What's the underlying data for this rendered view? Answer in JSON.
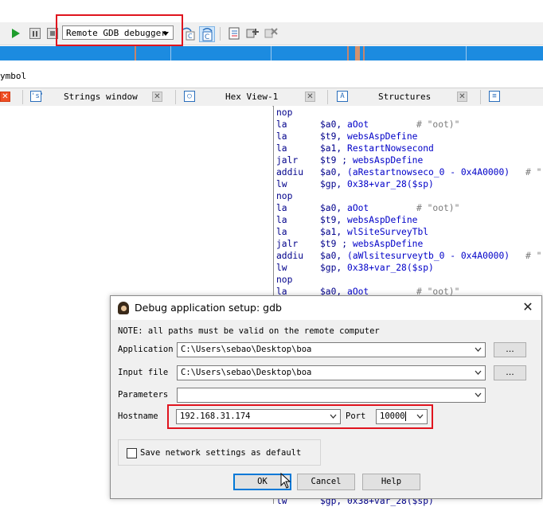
{
  "toolbar": {
    "debugger_select": "Remote GDB debugger"
  },
  "symbol_row": {
    "text": "ymbol"
  },
  "tabs": [
    {
      "label": "Strings window"
    },
    {
      "label": "Hex View-1"
    },
    {
      "label": "Structures"
    }
  ],
  "tab_icons": {
    "strings": "'s'",
    "structures": "A"
  },
  "code": [
    {
      "mnemonic": "nop"
    },
    {
      "mnemonic": "la",
      "reg": "$a0,",
      "arg": "aOot",
      "comment": "# \"oot)\""
    },
    {
      "mnemonic": "la",
      "reg": "$t9,",
      "arg": "websAspDefine"
    },
    {
      "mnemonic": "la",
      "reg": "$a1,",
      "arg": "RestartNowsecond"
    },
    {
      "mnemonic": "jalr",
      "reg": "$t9",
      "sep": " ;",
      "arg": "websAspDefine"
    },
    {
      "mnemonic": "addiu",
      "reg": "$a0,",
      "arg": "(aRestartnowseco_0 - 0x4A0000)",
      "comment": "# \""
    },
    {
      "mnemonic": "lw",
      "reg": "$gp,",
      "arg": "0x38+var_28($sp)"
    },
    {
      "mnemonic": "nop"
    },
    {
      "mnemonic": "la",
      "reg": "$a0,",
      "arg": "aOot",
      "comment": "# \"oot)\""
    },
    {
      "mnemonic": "la",
      "reg": "$t9,",
      "arg": "websAspDefine"
    },
    {
      "mnemonic": "la",
      "reg": "$a1,",
      "arg": "wlSiteSurveyTbl"
    },
    {
      "mnemonic": "jalr",
      "reg": "$t9",
      "sep": " ;",
      "arg": "websAspDefine"
    },
    {
      "mnemonic": "addiu",
      "reg": "$a0,",
      "arg": "(aWlsitesurveytb_0 - 0x4A0000)",
      "comment": "# \""
    },
    {
      "mnemonic": "lw",
      "reg": "$gp,",
      "arg": "0x38+var_28($sp)"
    },
    {
      "mnemonic": "nop"
    },
    {
      "mnemonic": "la",
      "reg": "$a0,",
      "arg": "aOot",
      "comment": "# \"oot)\""
    }
  ],
  "dialog": {
    "title": "Debug application setup: gdb",
    "note": "NOTE: all paths must be valid on the remote computer",
    "application_label": "Application",
    "application_value": "C:\\Users\\sebao\\Desktop\\boa",
    "input_file_label": "Input file",
    "input_file_value": "C:\\Users\\sebao\\Desktop\\boa",
    "parameters_label": "Parameters",
    "parameters_value": "",
    "hostname_label": "Hostname",
    "hostname_value": "192.168.31.174",
    "port_label": "Port",
    "port_value": "10000",
    "browse_label": "...",
    "save_settings_label": "Save network settings as default",
    "ok_label": "OK",
    "cancel_label": "Cancel",
    "help_label": "Help",
    "close_glyph": "✕"
  },
  "colors": {
    "highlight_red": "#e0141e",
    "nav_blue": "#1c8be0",
    "nav_marker": "#c8856b",
    "play_green": "#1f9d2d"
  }
}
